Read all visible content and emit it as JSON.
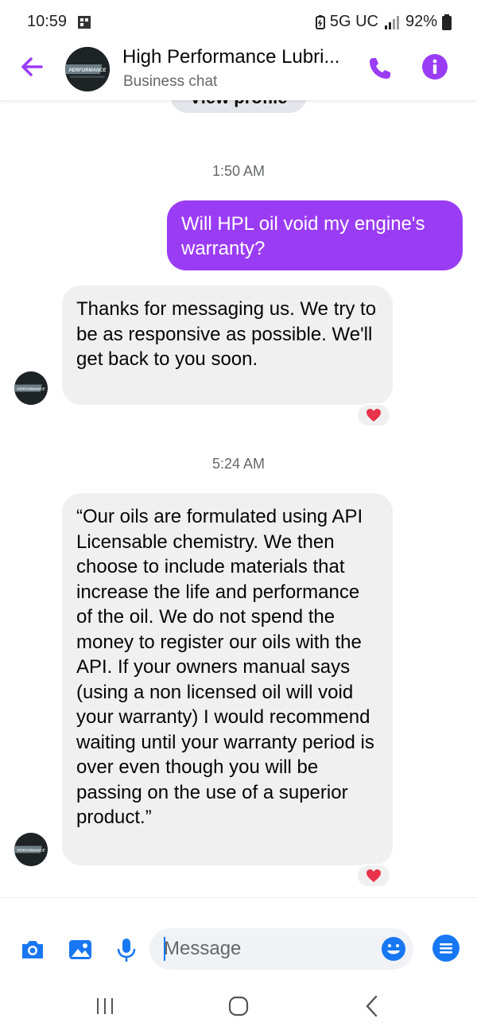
{
  "status_bar": {
    "time": "10:59",
    "network": "5G UC",
    "battery": "92%"
  },
  "header": {
    "title": "High Performance Lubri...",
    "subtitle": "Business chat",
    "avatar_text": "PERFORMANCE",
    "icons": [
      "arrow-left-icon",
      "phone-icon",
      "info-icon"
    ]
  },
  "chat": {
    "profile_pill_label": "View profile",
    "timestamps": [
      "1:50 AM",
      "5:24 AM"
    ],
    "messages": [
      {
        "direction": "outgoing",
        "text": "Will HPL oil void my engine's warranty?"
      },
      {
        "direction": "incoming",
        "text": "Thanks for messaging us. We try to be as responsive as possible. We'll get back to you soon.",
        "reaction": "heart"
      },
      {
        "direction": "incoming",
        "text": "“Our oils are formulated using API Licensable chemistry.  We then choose to include materials that increase the life and performance of the oil.  We do not spend the money to register our oils with the API.  If your owners manual says (using a non licensed oil will void your warranty) I would recommend waiting until your warranty period is over even though you will be passing on the use of a superior product.”",
        "reaction": "heart"
      }
    ]
  },
  "composer": {
    "placeholder": "Message",
    "value": "",
    "icons": [
      "camera-icon",
      "image-icon",
      "microphone-icon",
      "emoji-icon",
      "menu-icon"
    ]
  },
  "colors": {
    "accent_purple": "#9b3cf5",
    "send_blue": "#1877f2",
    "incoming_bubble": "#f0f0f0",
    "reaction_red": "#e8334a"
  }
}
